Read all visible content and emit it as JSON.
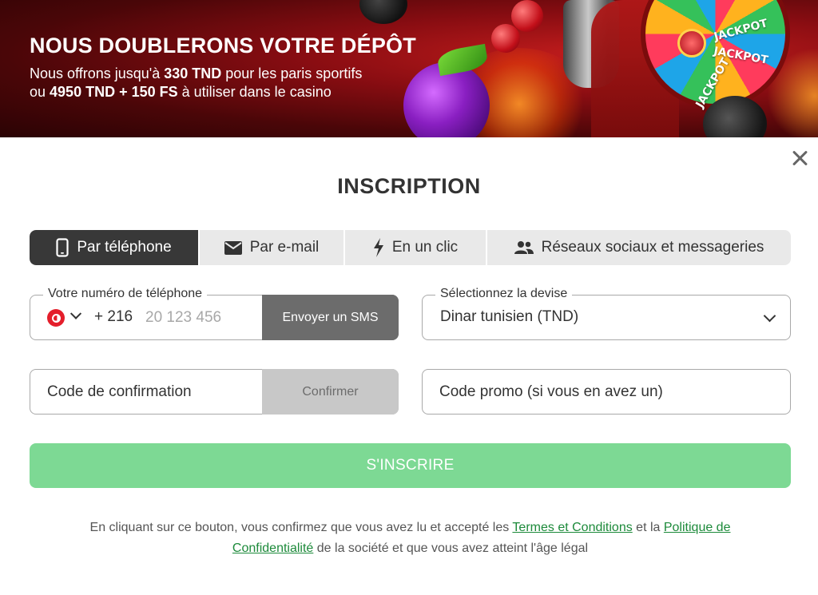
{
  "banner": {
    "title": "NOUS DOUBLERONS VOTRE DÉPÔT",
    "line1_prefix": "Nous offrons jusqu'à ",
    "line1_bold": "330 TND",
    "line1_suffix": " pour les paris sportifs",
    "line2_prefix": "ou ",
    "line2_bold": "4950 TND + 150 FS",
    "line2_suffix": " à utiliser dans le casino",
    "wheel_labels": [
      "JACKPOT",
      "JACKPOT",
      "JACKPOT"
    ]
  },
  "modal": {
    "title": "INSCRIPTION",
    "close_icon": "close-icon"
  },
  "tabs": [
    {
      "label": "Par téléphone",
      "icon": "smartphone-icon",
      "active": true
    },
    {
      "label": "Par e-mail",
      "icon": "envelope-icon",
      "active": false
    },
    {
      "label": "En un clic",
      "icon": "lightning-icon",
      "active": false
    },
    {
      "label": "Réseaux sociaux et messageries",
      "icon": "users-icon",
      "active": false
    }
  ],
  "phone": {
    "label": "Votre numéro de téléphone",
    "country_icon": "tunisia-flag-icon",
    "dial_code": "+ 216",
    "placeholder": "20 123 456",
    "sms_button": "Envoyer un SMS"
  },
  "currency": {
    "label": "Sélectionnez la devise",
    "value": "Dinar tunisien (TND)"
  },
  "confirmation": {
    "placeholder": "Code de confirmation",
    "button": "Confirmer"
  },
  "promo": {
    "placeholder": "Code promo (si vous en avez un)"
  },
  "submit": {
    "label": "S'INSCRIRE"
  },
  "legal": {
    "part1": "En cliquant sur ce bouton, vous confirmez que vous avez lu et accepté les ",
    "terms_link": "Termes et Conditions",
    "part2": " et la ",
    "privacy_link": "Politique de Confidentialité",
    "part3": " de la société et que vous avez atteint l'âge légal"
  },
  "colors": {
    "active_tab": "#383838",
    "submit_green": "#7dd994",
    "link_green": "#1c8a3a",
    "sms_button": "#6c6c6c",
    "banner_red": "#8a0d12"
  }
}
